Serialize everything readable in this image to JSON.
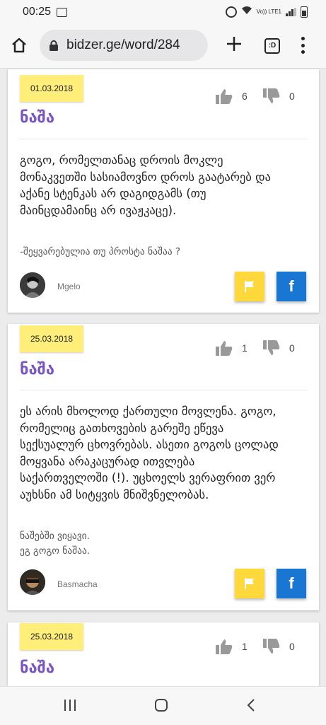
{
  "status_bar": {
    "time": "00:25",
    "lte_label": "Vo)) LTE1"
  },
  "browser": {
    "url": "bidzer.ge/word/284",
    "tabs_label": ":D"
  },
  "entries": [
    {
      "date": "01.03.2018",
      "likes": "6",
      "dislikes": "0",
      "word": "ნაშა",
      "definition": "გოგო, რომელთანაც დროის მოკლე მონაკვეთში სასიამოვნო დროს გაატარებ და აქანე სტენკას არ დაგიდგამს (თუ მაინცდამაინც არ ივაჟკაცე).",
      "example": "-შეყვარებულია თუ პროსტა ნაშაა ?",
      "author": "Mgelo"
    },
    {
      "date": "25.03.2018",
      "likes": "1",
      "dislikes": "0",
      "word": "ნაშა",
      "definition": "ეს არის მხოლოდ ქართული მოვლენა. გოგო, რომელიც გათხოვების გარეშე ეწევა სექსუალურ ცხოვრებას. ასეთი გოგოს ცოლად მოყვანა არაკაცურად ითვლება საქართველოში (!). უცხოელს ვერაფრით ვერ აუხსნი ამ სიტყვის მნიშვნელობას.",
      "example": "ნაშებში ვიყავი.\nეგ გოგო ნაშაა.",
      "author": "Basmacha"
    },
    {
      "date": "25.03.2018",
      "likes": "1",
      "dislikes": "0",
      "word": "ნაშა"
    }
  ],
  "colors": {
    "title": "#7a56c2",
    "date_badge": "#ffef7a",
    "flag_button": "#ffd83b",
    "facebook_button": "#1976d2"
  },
  "icons": [
    "home-icon",
    "lock-icon",
    "plus-icon",
    "tabs-icon",
    "menu-icon",
    "thumbs-up-icon",
    "thumbs-down-icon",
    "flag-icon",
    "facebook-icon",
    "recent-apps-icon",
    "home-nav-icon",
    "back-icon"
  ]
}
